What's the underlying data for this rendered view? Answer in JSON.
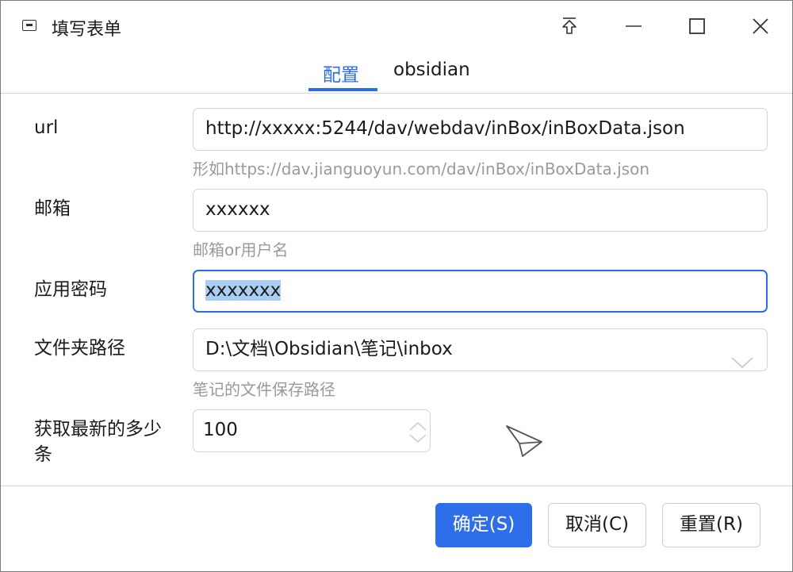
{
  "window": {
    "title": "填写表单",
    "icon": "app-window-icon"
  },
  "tabs": [
    {
      "label": "配置",
      "active": true
    },
    {
      "label": "obsidian",
      "active": false
    }
  ],
  "form": {
    "url": {
      "label": "url",
      "value": "http://xxxxx:5244/dav/webdav/inBox/inBoxData.json",
      "hint": "形如https://dav.jianguoyun.com/dav/inBox/inBoxData.json"
    },
    "email": {
      "label": "邮箱",
      "value": "xxxxxx",
      "hint": "邮箱or用户名"
    },
    "password": {
      "label": "应用密码",
      "value": "xxxxxxx"
    },
    "folder": {
      "label": "文件夹路径",
      "value": "D:\\文档\\Obsidian\\笔记\\inbox",
      "hint": "笔记的文件保存路径"
    },
    "count": {
      "label_line1": "获取最新的多少",
      "label_line2": "条",
      "value": "100"
    }
  },
  "buttons": {
    "ok": "确定(S)",
    "cancel": "取消(C)",
    "reset": "重置(R)"
  },
  "colors": {
    "accent": "#2b6de8",
    "selection": "#a9cdf3"
  }
}
